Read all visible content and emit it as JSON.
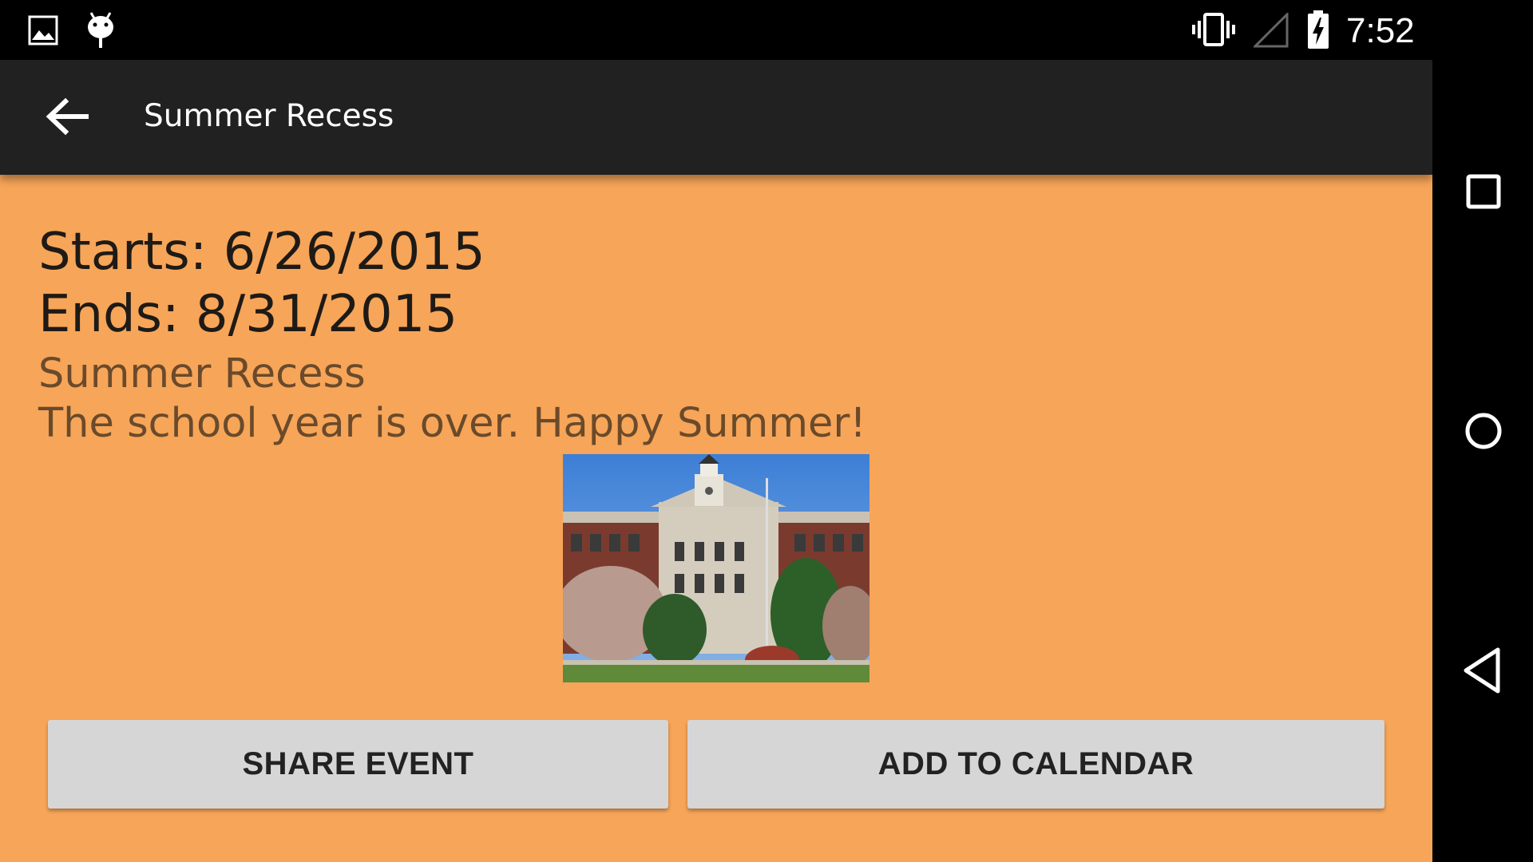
{
  "status_bar": {
    "time": "7:52",
    "icons": [
      "gallery-icon",
      "android-debug-icon",
      "vibrate-icon",
      "signal-icon",
      "battery-charging-icon"
    ]
  },
  "app_bar": {
    "back_icon": "arrow-back-icon",
    "title": "Summer Recess"
  },
  "event": {
    "starts": "Starts: 6/26/2015",
    "ends": "Ends: 8/31/2015",
    "title": "Summer Recess",
    "description": "The school year is over. Happy Summer!"
  },
  "buttons": {
    "share": "SHARE EVENT",
    "calendar": "ADD TO CALENDAR"
  },
  "nav_bar": {
    "icons": [
      "recents-icon",
      "home-icon",
      "back-icon"
    ]
  },
  "colors": {
    "background": "#f7a558",
    "app_bar": "#212121",
    "button": "#d6d6d6"
  }
}
